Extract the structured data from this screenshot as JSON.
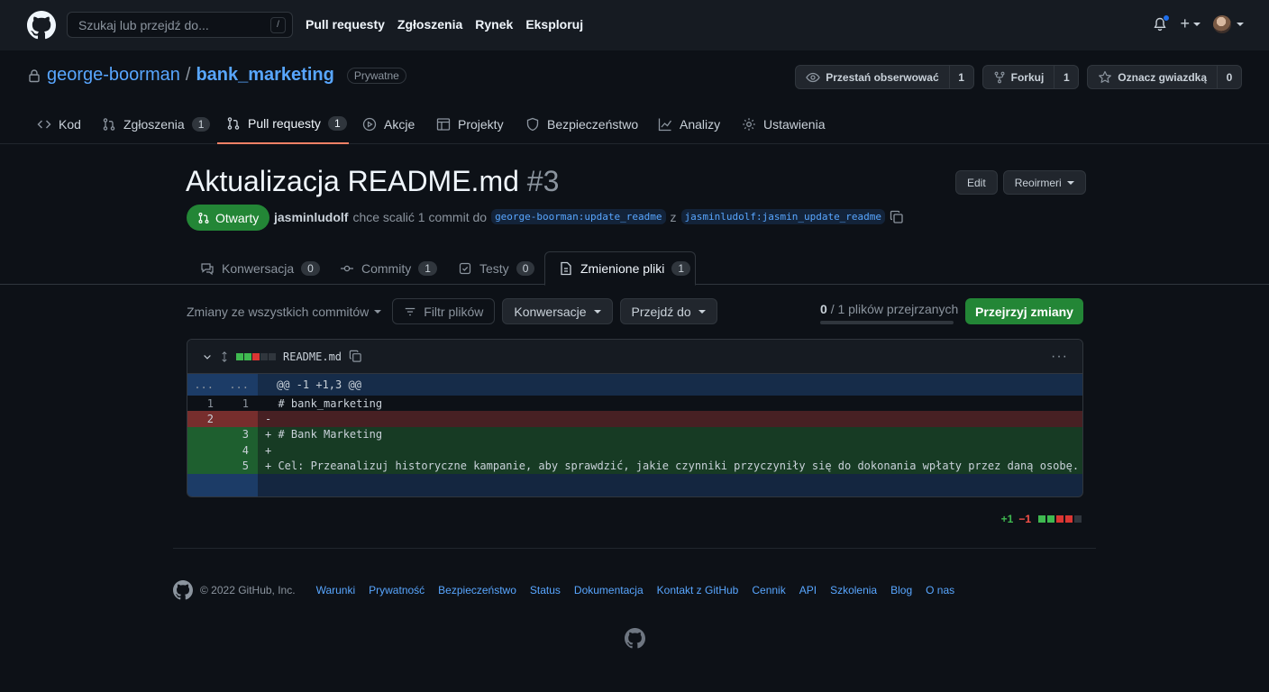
{
  "header": {
    "search_placeholder": "Szukaj lub przejdź do...",
    "search_shortcut": "/",
    "nav": [
      "Pull requesty",
      "Zgłoszenia",
      "Rynek",
      "Eksploruj"
    ],
    "plus_label": "+"
  },
  "repo": {
    "owner": "george-boorman",
    "separator": "/",
    "name": "bank_marketing",
    "visibility": "Prywatne",
    "actions": {
      "watch_label": "Przestań obserwować",
      "watch_count": "1",
      "fork_label": "Forkuj",
      "fork_count": "1",
      "star_label": "Oznacz gwiazdką",
      "star_count": "0"
    },
    "tabs": [
      {
        "label": "Kod",
        "count": ""
      },
      {
        "label": "Zgłoszenia",
        "count": "1"
      },
      {
        "label": "Pull requesty",
        "count": "1"
      },
      {
        "label": "Akcje",
        "count": ""
      },
      {
        "label": "Projekty",
        "count": ""
      },
      {
        "label": "Bezpieczeństwo",
        "count": ""
      },
      {
        "label": "Analizy",
        "count": ""
      },
      {
        "label": "Ustawienia",
        "count": ""
      }
    ]
  },
  "pr": {
    "title": "Aktualizacja README.md",
    "number": "#3",
    "edit_label": "Edit",
    "code_label": "Reoirmeri",
    "state": "Otwarty",
    "author": "jasminludolf",
    "meta_text": "chce scalić 1 commit do",
    "base_branch": "george-boorman:update_readme",
    "from_word": "z",
    "head_branch": "jasminludolf:jasmin_update_readme",
    "tabs": [
      {
        "label": "Konwersacja",
        "count": "0"
      },
      {
        "label": "Commity",
        "count": "1"
      },
      {
        "label": "Testy",
        "count": "0"
      },
      {
        "label": "Zmienione pliki",
        "count": "1"
      }
    ],
    "diffstat": {
      "additions": "+1",
      "deletions": "−1"
    }
  },
  "toolbar": {
    "compare_label": "Zmiany ze wszystkich commitów",
    "filter_label": "Filtr plików",
    "conversations_label": "Konwersacje",
    "jump_label": "Przejdź do",
    "viewed_done": "0",
    "viewed_rest": "/ 1 plików przejrzanych",
    "review_label": "Przejrzyj zmiany"
  },
  "file": {
    "name": "README.md",
    "hunk_left": "...",
    "hunk_right": "...",
    "hunk_header": "@@ -1 +1,3 @@",
    "lines": [
      {
        "type": "ctx",
        "old": "1",
        "new": "1",
        "text": "  # bank_marketing"
      },
      {
        "type": "del",
        "old": "2",
        "new": "",
        "text": "-"
      },
      {
        "type": "add",
        "old": "",
        "new": "3",
        "text": "+ # Bank Marketing"
      },
      {
        "type": "add",
        "old": "",
        "new": "4",
        "text": "+"
      },
      {
        "type": "add",
        "old": "",
        "new": "5",
        "text": "+ Cel: Przeanalizuj historyczne kampanie, aby sprawdzić, jakie czynniki przyczyniły się do dokonania wpłaty przez daną osobę."
      }
    ]
  },
  "footer": {
    "copyright": "© 2022 GitHub, Inc.",
    "links": [
      "Warunki",
      "Prywatność",
      "Bezpieczeństwo",
      "Status",
      "Dokumentacja",
      "Kontakt z GitHub",
      "Cennik",
      "API",
      "Szkolenia",
      "Blog",
      "O nas"
    ]
  },
  "colors": {
    "accent_blue": "#58a6ff",
    "success_green": "#238636",
    "tab_underline": "#f78166",
    "background": "#0d1117"
  }
}
